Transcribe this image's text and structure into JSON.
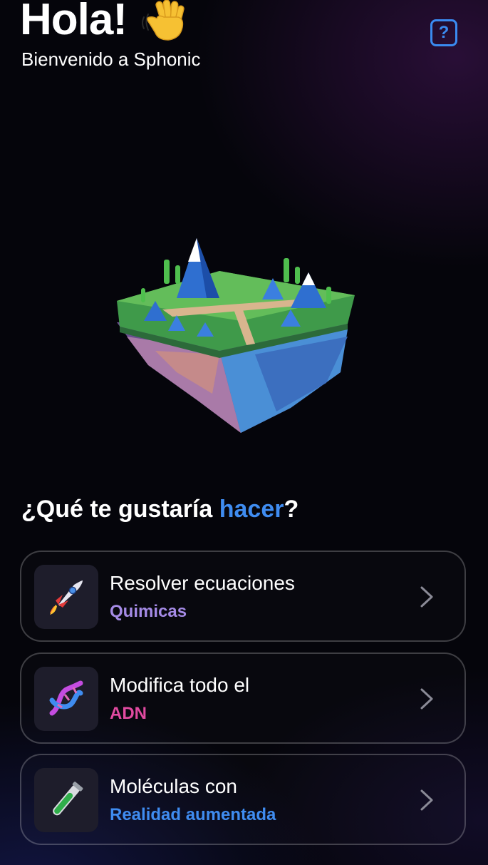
{
  "header": {
    "greeting": "Hola!",
    "subtitle": "Bienvenido a Sphonic",
    "help_label": "?"
  },
  "prompt": {
    "before": "¿Qué te gustaría ",
    "accent": "hacer",
    "after": "?"
  },
  "options": [
    {
      "title": "Resolver ecuaciones",
      "subtitle": "Quimicas",
      "subtitle_color": "#a58be6",
      "icon": "rocket-icon"
    },
    {
      "title": "Modifica todo el",
      "subtitle": "ADN",
      "subtitle_color": "#e14aa0",
      "icon": "dna-icon"
    },
    {
      "title": "Moléculas con",
      "subtitle": "Realidad aumentada",
      "subtitle_color": "#3f8cf0",
      "icon": "test-tube-icon"
    }
  ],
  "colors": {
    "accent": "#3f8cf0",
    "background": "#05050b"
  }
}
